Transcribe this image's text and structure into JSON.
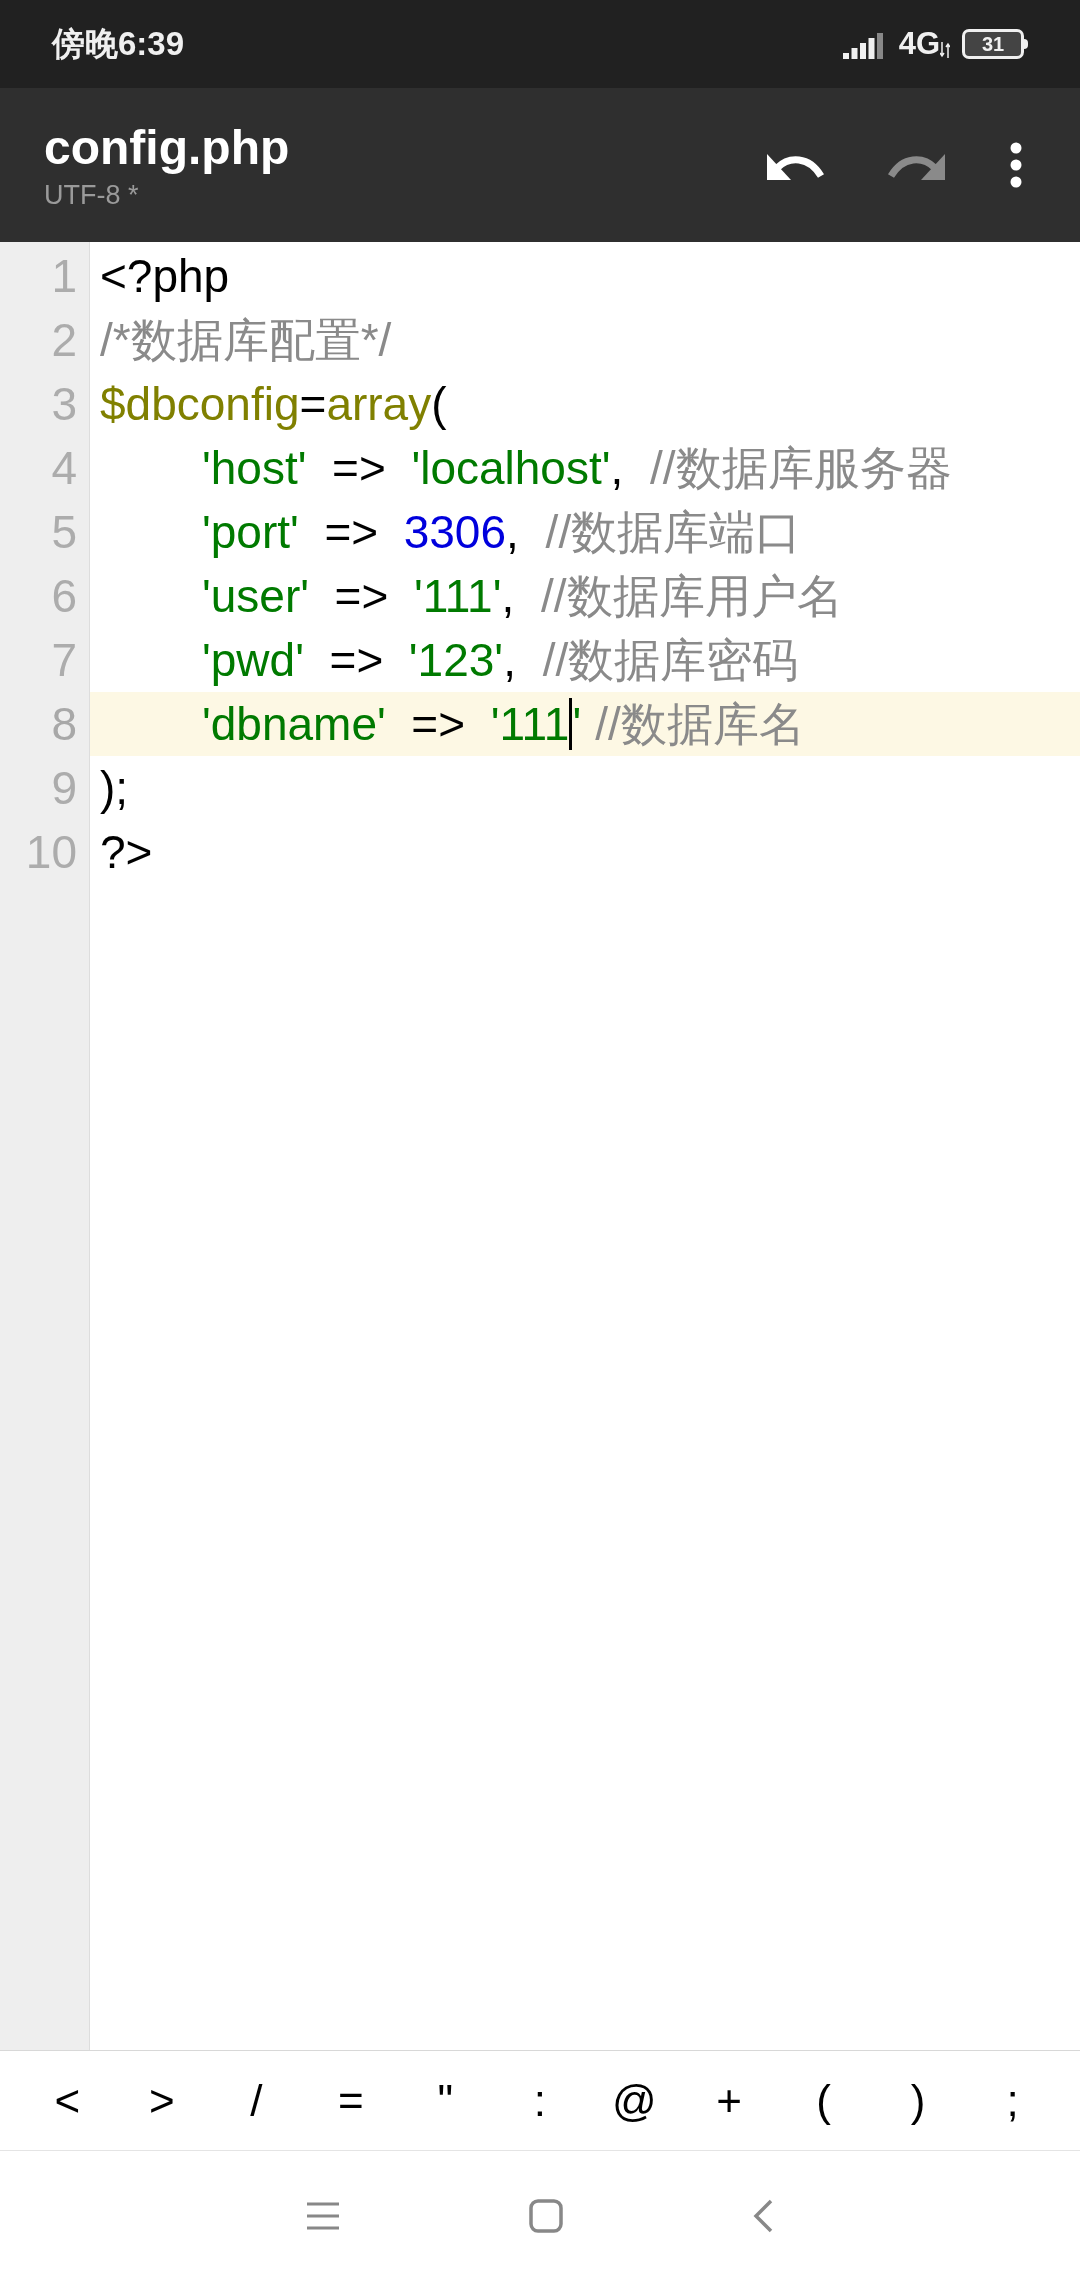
{
  "status_bar": {
    "time": "傍晚6:39",
    "network": "4G",
    "battery": "31"
  },
  "toolbar": {
    "title": "config.php",
    "subtitle": "UTF-8 *",
    "undo": {
      "disabled": false
    },
    "redo": {
      "disabled": true
    }
  },
  "editor": {
    "lines": [
      {
        "number": "1",
        "current": false,
        "tokens": [
          {
            "text": "<?php",
            "kind": "plain"
          }
        ]
      },
      {
        "number": "2",
        "current": false,
        "tokens": [
          {
            "text": "/*数据库配置*/",
            "kind": "comment"
          }
        ]
      },
      {
        "number": "3",
        "current": false,
        "tokens": [
          {
            "text": "$dbconfig",
            "kind": "keyword"
          },
          {
            "text": "=",
            "kind": "plain"
          },
          {
            "text": "array",
            "kind": "keyword"
          },
          {
            "text": "(",
            "kind": "plain"
          }
        ]
      },
      {
        "number": "4",
        "current": false,
        "tokens": [
          {
            "kind": "indent"
          },
          {
            "text": "'host'",
            "kind": "string"
          },
          {
            "text": "  =>  ",
            "kind": "plain"
          },
          {
            "text": "'localhost'",
            "kind": "string"
          },
          {
            "text": ", ",
            "kind": "plain"
          },
          {
            "text": "//数据库服务器",
            "kind": "comment"
          }
        ]
      },
      {
        "number": "5",
        "current": false,
        "tokens": [
          {
            "kind": "indent"
          },
          {
            "text": "'port'",
            "kind": "string"
          },
          {
            "text": "  =>  ",
            "kind": "plain"
          },
          {
            "text": "3306",
            "kind": "number"
          },
          {
            "text": ", ",
            "kind": "plain"
          },
          {
            "text": "//数据库端口",
            "kind": "comment"
          }
        ]
      },
      {
        "number": "6",
        "current": false,
        "tokens": [
          {
            "kind": "indent"
          },
          {
            "text": "'user'",
            "kind": "string"
          },
          {
            "text": "  =>  ",
            "kind": "plain"
          },
          {
            "text": "'111'",
            "kind": "string"
          },
          {
            "text": ", ",
            "kind": "plain"
          },
          {
            "text": "//数据库用户名",
            "kind": "comment"
          }
        ]
      },
      {
        "number": "7",
        "current": false,
        "tokens": [
          {
            "kind": "indent"
          },
          {
            "text": "'pwd'",
            "kind": "string"
          },
          {
            "text": "  =>  ",
            "kind": "plain"
          },
          {
            "text": "'123'",
            "kind": "string"
          },
          {
            "text": ", ",
            "kind": "plain"
          },
          {
            "text": "//数据库密码",
            "kind": "comment"
          }
        ]
      },
      {
        "number": "8",
        "current": true,
        "tokens": [
          {
            "kind": "indent"
          },
          {
            "text": "'dbname'",
            "kind": "string"
          },
          {
            "text": "  =>  ",
            "kind": "plain"
          },
          {
            "text": "'111",
            "kind": "string"
          },
          {
            "kind": "cursor"
          },
          {
            "text": "'",
            "kind": "string"
          },
          {
            "text": "//数据库名",
            "kind": "comment"
          }
        ]
      },
      {
        "number": "9",
        "current": false,
        "tokens": [
          {
            "text": ");",
            "kind": "plain"
          }
        ]
      },
      {
        "number": "10",
        "current": false,
        "tokens": [
          {
            "text": "?>",
            "kind": "plain"
          }
        ]
      }
    ]
  },
  "symbol_keys": [
    "<",
    ">",
    "/",
    "=",
    "\"",
    ":",
    "@",
    "+",
    "(",
    ")",
    ";"
  ]
}
